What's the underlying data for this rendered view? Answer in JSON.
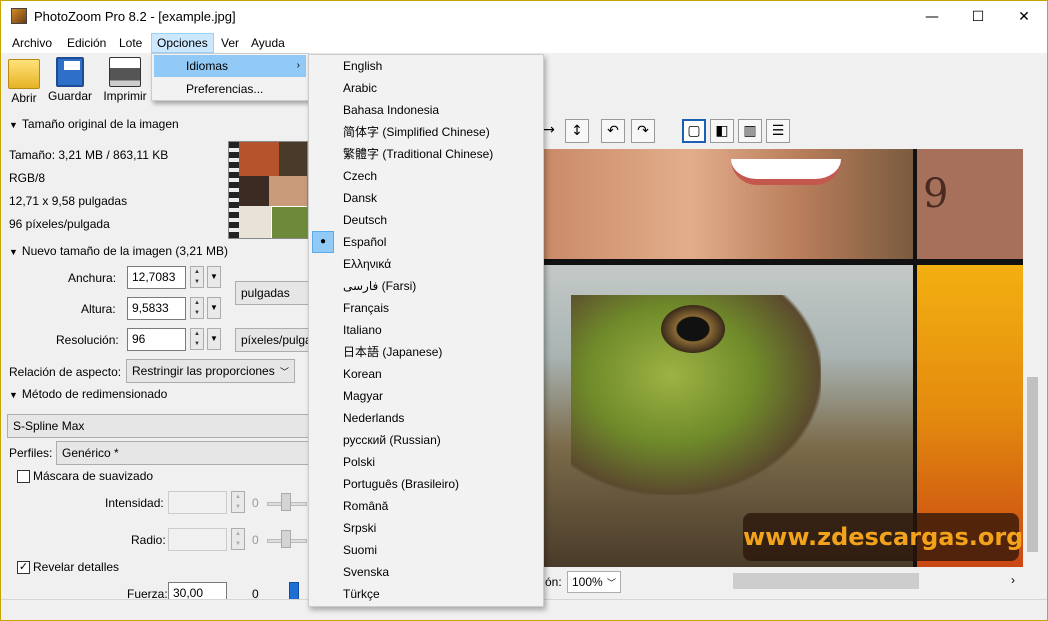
{
  "window": {
    "title": "PhotoZoom Pro 8.2 - [example.jpg]",
    "minimize": "—",
    "maximize": "☐",
    "close": "✕"
  },
  "menubar": [
    "Archivo",
    "Edición",
    "Lote",
    "Opciones",
    "Ver",
    "Ayuda"
  ],
  "toolbar": {
    "open": "Abrir",
    "save": "Guardar",
    "print": "Imprimir"
  },
  "options_menu": {
    "languages": "Idiomas",
    "preferences": "Preferencias...",
    "submenu_arrow": "›"
  },
  "languages": [
    "English",
    "Arabic",
    "Bahasa Indonesia",
    "简体字 (Simplified Chinese)",
    "繁體字 (Traditional Chinese)",
    "Czech",
    "Dansk",
    "Deutsch",
    "Español",
    "Ελληνικά",
    "فارسی (Farsi)",
    "Français",
    "Italiano",
    "日本語 (Japanese)",
    "Korean",
    "Magyar",
    "Nederlands",
    "русский (Russian)",
    "Polski",
    "Português (Brasileiro)",
    "Română",
    "Srpski",
    "Suomi",
    "Svenska",
    "Türkçe"
  ],
  "selected_language": "Español",
  "left_panel": {
    "original_size_title": "Tamaño original de la imagen",
    "size_line": "Tamaño: 3,21 MB / 863,11 KB",
    "color_mode": "RGB/8",
    "dimensions": "12,71 x 9,58 pulgadas",
    "density": "96 píxeles/pulgada",
    "new_size_title": "Nuevo tamaño de la imagen (3,21 MB)",
    "width_label": "Anchura:",
    "width_value": "12,7083",
    "height_label": "Altura:",
    "height_value": "9,5833",
    "unit": "pulgadas",
    "resolution_label": "Resolución:",
    "resolution_value": "96",
    "resolution_unit": "píxeles/pulga",
    "aspect_label": "Relación de aspecto:",
    "aspect_value": "Restringir las proporciones",
    "method_title": "Método de redimensionado",
    "method_value": "S-Spline Max",
    "profiles_label": "Perfiles:",
    "profiles_value": "Genérico *",
    "smoothing_mask": "Máscara de suavizado",
    "intensity_label": "Intensidad:",
    "intensity_zero": "0",
    "radius_label": "Radio:",
    "radius_zero": "0",
    "reveal_details": "Revelar detalles",
    "force_label": "Fuerza:",
    "force_value": "30,00",
    "force_zero": "0"
  },
  "viewer": {
    "zoom_label": "ón:",
    "zoom_value": "100%",
    "watermark": "www.zdescargas.org",
    "tool_icons": [
      "→",
      "↕",
      "↶",
      "↷",
      "▢",
      "◧",
      "▥",
      "☰"
    ]
  },
  "colors": {
    "menu_highlight": "#91c9f7",
    "menubar_active": "#cce8ff",
    "watermark_text": "#f2a31b"
  }
}
